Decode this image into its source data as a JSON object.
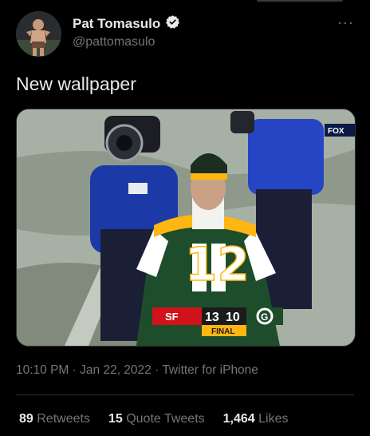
{
  "user": {
    "display_name": "Pat Tomasulo",
    "handle": "@pattomasulo",
    "verified_icon": "verified-badge-icon"
  },
  "more_icon": "more-options-icon",
  "tweet": {
    "text": "New wallpaper"
  },
  "media": {
    "network_bug": "FOX",
    "player_cap_number": "12",
    "scoreboard": {
      "away_logo": "SF",
      "away_score": "13",
      "home_score": "10",
      "home_logo": "G",
      "status": "FINAL"
    },
    "colors": {
      "away": "#d0121b",
      "home": "#1e4d2b",
      "gold": "#ffb612"
    }
  },
  "meta": {
    "time": "10:10 PM",
    "sep1": "·",
    "date": "Jan 22, 2022",
    "sep2": "·",
    "source": "Twitter for iPhone"
  },
  "stats": {
    "retweets_count": "89",
    "retweets_label": "Retweets",
    "quotes_count": "15",
    "quotes_label": "Quote Tweets",
    "likes_count": "1,464",
    "likes_label": "Likes"
  }
}
